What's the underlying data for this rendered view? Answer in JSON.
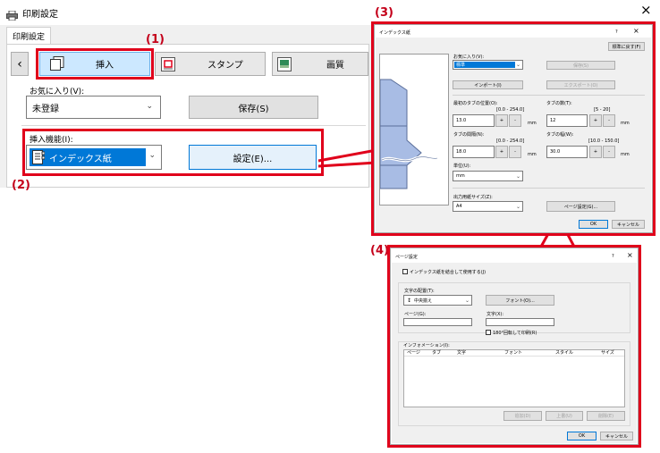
{
  "main_window": {
    "title": "印刷設定",
    "close_glyph": "×",
    "tab_label": "印刷設定",
    "tabs": {
      "prev": "‹",
      "insert": "挿入",
      "stamp": "スタンプ",
      "image_quality": "画質"
    },
    "favorites_label": "お気に入り(V):",
    "favorites_value": "未登録",
    "save_button": "保存(S)",
    "insert_function_label": "挿入機能(I):",
    "insert_function_value": "インデックス紙",
    "settings_button": "設定(E)..."
  },
  "callouts": {
    "c1": "(1)",
    "c2": "(2)",
    "c3": "(3)",
    "c4": "(4)"
  },
  "index_dialog": {
    "title": "インデックス紙",
    "help": "?",
    "close": "×",
    "reset_button": "標準に戻す(F)",
    "favorites_label": "お気に入り(V):",
    "favorites_value": "標準",
    "save_button": "保存(S)",
    "import_button": "インポート(I)",
    "export_button": "エクスポート(O)",
    "first_tab_pos_label": "最初のタブの位置(O):",
    "first_tab_pos_range": "[0.0 - 254.0]",
    "first_tab_pos_value": "13.0",
    "tab_count_label": "タブの数(T):",
    "tab_count_range": "[5 - 20]",
    "tab_count_value": "12",
    "tab_spacing_label": "タブの間隔(N):",
    "tab_spacing_range": "[0.0 - 254.0]",
    "tab_spacing_value": "18.0",
    "tab_width_label": "タブの幅(W):",
    "tab_width_range": "[10.0 - 150.0]",
    "tab_width_value": "30.0",
    "unit_mm": "mm",
    "plus": "+",
    "minus": "-",
    "unit_label": "単位(U):",
    "unit_value": "mm",
    "paper_size_label": "出力用紙サイズ(Z):",
    "paper_size_value": "A4",
    "page_setup_button": "ページ設定(G)...",
    "ok": "OK",
    "cancel": "キャンセル"
  },
  "page_dialog": {
    "title": "ページ設定",
    "help": "?",
    "close": "×",
    "checkbox_label": "インデックス紙を結合して使用する(J)",
    "text_position_label": "文字の配置(T):",
    "text_position_value": "中央揃え",
    "font_button": "フォント(O)...",
    "page_label": "ページ(G):",
    "text_label": "文字(X):",
    "rotate_label": "180°回転して印刷(R)",
    "info_group_label": "インフォメーション(I):",
    "columns": [
      "ページ",
      "タブ",
      "文字",
      "フォント",
      "スタイル",
      "サイズ"
    ],
    "add_button": "追加(D)",
    "edit_button": "上書(U)",
    "delete_button": "削除(E)",
    "ok": "OK",
    "cancel": "キャンセル"
  },
  "colors": {
    "accent": "#cce8ff",
    "selected": "#0078d7",
    "callout": "#e0001b"
  }
}
